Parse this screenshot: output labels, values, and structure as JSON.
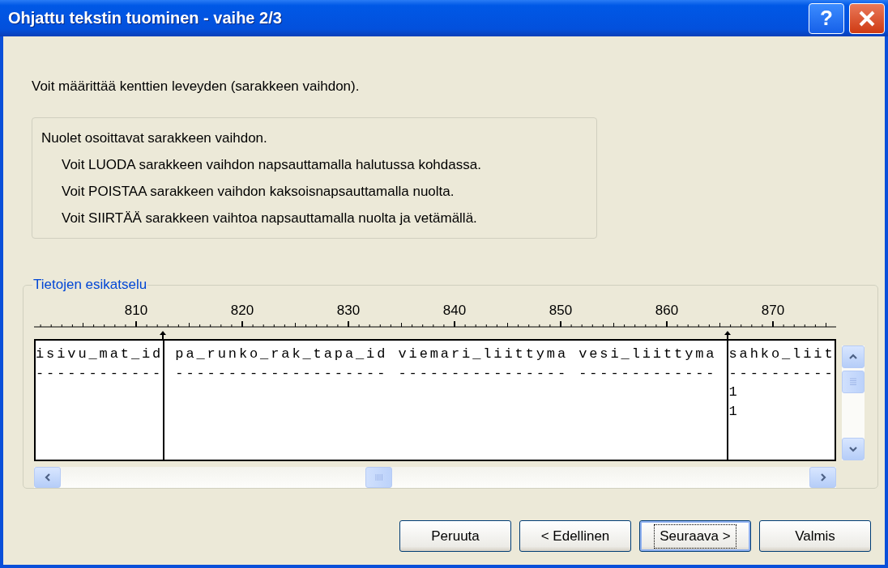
{
  "window": {
    "title": "Ohjattu tekstin tuominen - vaihe 2/3",
    "help_label": "?"
  },
  "intro": "Voit määrittää kenttien leveyden (sarakkeen vaihdon).",
  "info": {
    "heading": "Nuolet osoittavat sarakkeen vaihdon.",
    "lines": [
      "Voit LUODA sarakkeen vaihdon napsauttamalla halutussa kohdassa.",
      "Voit POISTAA sarakkeen vaihdon kaksoisnapsauttamalla nuolta.",
      "Voit SIIRTÄÄ sarakkeen vaihtoa napsauttamalla nuolta ja vetämällä."
    ]
  },
  "preview": {
    "title": "Tietojen esikatselu",
    "ruler": [
      "810",
      "820",
      "830",
      "840",
      "850",
      "860",
      "870"
    ],
    "fields": [
      {
        "lines": [
          "isivu_mat_id",
          "------------"
        ]
      },
      {
        "lines": [
          " pa_runko_rak_tapa_id viemari_liittyma vesi_liittyma ",
          " -------------------- ---------------- ------------- "
        ]
      },
      {
        "lines": [
          "sahko_liit",
          "----------",
          "1",
          "1"
        ]
      }
    ]
  },
  "buttons": [
    {
      "label": "Peruuta",
      "default": false
    },
    {
      "label": "< Edellinen",
      "default": false
    },
    {
      "label": "Seuraava >",
      "default": true
    },
    {
      "label": "Valmis",
      "default": false
    }
  ]
}
